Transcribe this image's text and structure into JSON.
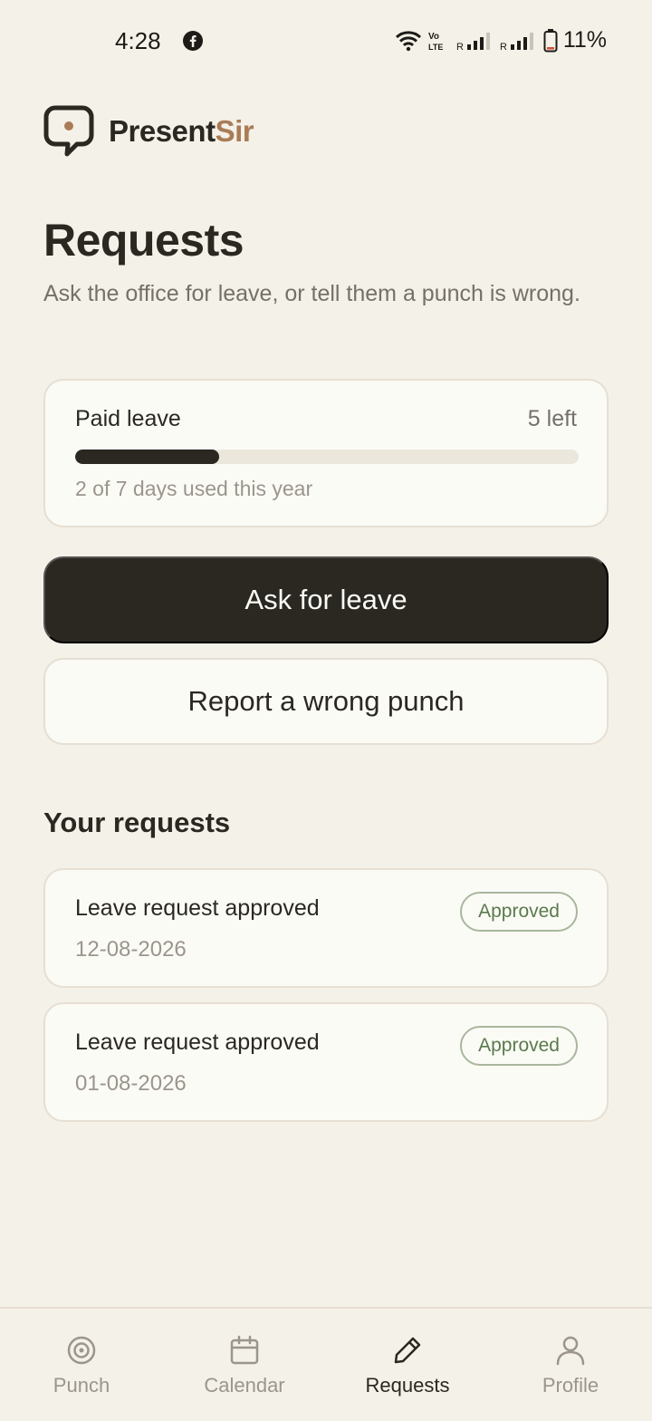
{
  "status_bar": {
    "time": "4:28",
    "network": "Vo LTE",
    "battery": "11%"
  },
  "brand": {
    "name_part1": "Present",
    "name_part2": "Sir",
    "accent_color": "#a97c56"
  },
  "page": {
    "title": "Requests",
    "subtitle": "Ask the office for leave, or tell them a punch is wrong."
  },
  "leave_balance": {
    "title": "Paid leave",
    "remaining": "5 left",
    "used": 2,
    "total": 7,
    "caption": "2 of 7 days used this year"
  },
  "actions": {
    "ask_leave": "Ask for leave",
    "report_punch": "Report a wrong punch"
  },
  "requests": {
    "section_title": "Your requests",
    "items": [
      {
        "title": "Leave request approved",
        "date": "12-08-2026",
        "status": "Approved"
      },
      {
        "title": "Leave request approved",
        "date": "01-08-2026",
        "status": "Approved"
      }
    ]
  },
  "nav": {
    "items": [
      {
        "label": "Punch",
        "icon": "target-icon"
      },
      {
        "label": "Calendar",
        "icon": "calendar-icon"
      },
      {
        "label": "Requests",
        "icon": "pencil-icon"
      },
      {
        "label": "Profile",
        "icon": "person-icon"
      }
    ],
    "active": "Requests"
  },
  "colors": {
    "background": "#f4f1e8",
    "primary": "#2b2822",
    "approved": "#5a7a4c"
  }
}
